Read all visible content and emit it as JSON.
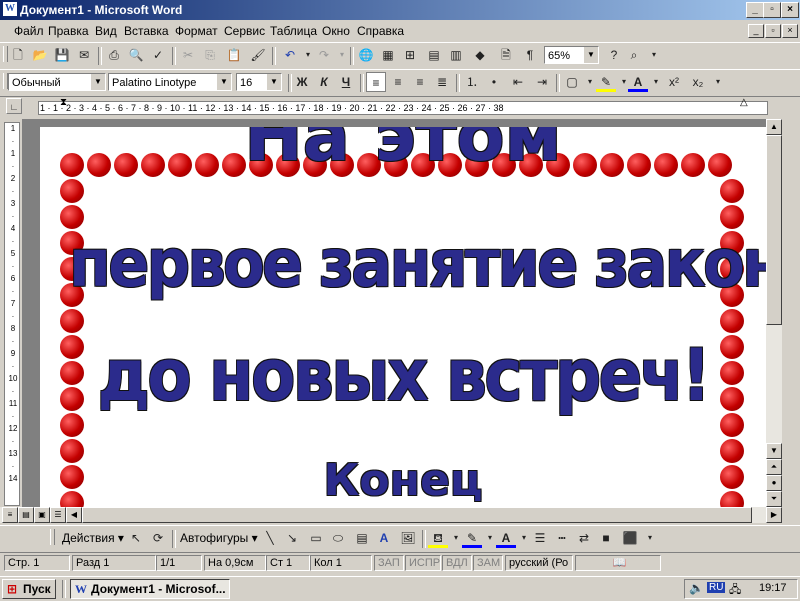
{
  "window": {
    "title": "Документ1 - Microsoft Word",
    "app_icon": "W"
  },
  "menu": [
    "Файл",
    "Правка",
    "Вид",
    "Вставка",
    "Формат",
    "Сервис",
    "Таблица",
    "Окно",
    "Справка"
  ],
  "standard_toolbar": {
    "zoom": "65%"
  },
  "format_toolbar": {
    "style": "Обычный",
    "font": "Palatino Linotype",
    "size": "16",
    "bold_label": "Ж",
    "italic_label": "К",
    "underline_label": "Ч"
  },
  "ruler": {
    "labels": "1 · 1 · 2 · 3 · 4 · 5 · 6 · 7 · 8 · 9 · 10 · 11 · 12 · 13 · 14 · 15 · 16 · 17 · 18 · 19 · 20 · 21 · 22 · 23 · 24 · 25 · 26 · 27 · 38",
    "vertical_labels": [
      "1",
      "·",
      "1",
      "·",
      "2",
      "·",
      "3",
      "·",
      "4",
      "·",
      "5",
      "·",
      "6",
      "·",
      "7",
      "·",
      "8",
      "·",
      "9",
      "·",
      "10",
      "·",
      "11",
      "·",
      "12",
      "·",
      "13",
      "·",
      "14"
    ]
  },
  "document": {
    "line1": "На этом",
    "line2": "первое занятие закончено,",
    "line3": "до новых встреч!",
    "line4": "Конец"
  },
  "drawing_toolbar": {
    "actions": "Действия",
    "autoshapes": "Автофигуры"
  },
  "status": {
    "page": "Стр. 1",
    "section": "Разд 1",
    "pages": "1/1",
    "at": "На 0,9см",
    "line": "Ст 1",
    "col": "Кол 1",
    "rec": "ЗАП",
    "trk": "ИСПР",
    "ext": "ВДЛ",
    "ovr": "ЗАМ",
    "lang": "русский (Ро"
  },
  "taskbar": {
    "start": "Пуск",
    "doc": "Документ1 - Microsof...",
    "lang": "RU",
    "time": "19:17"
  }
}
